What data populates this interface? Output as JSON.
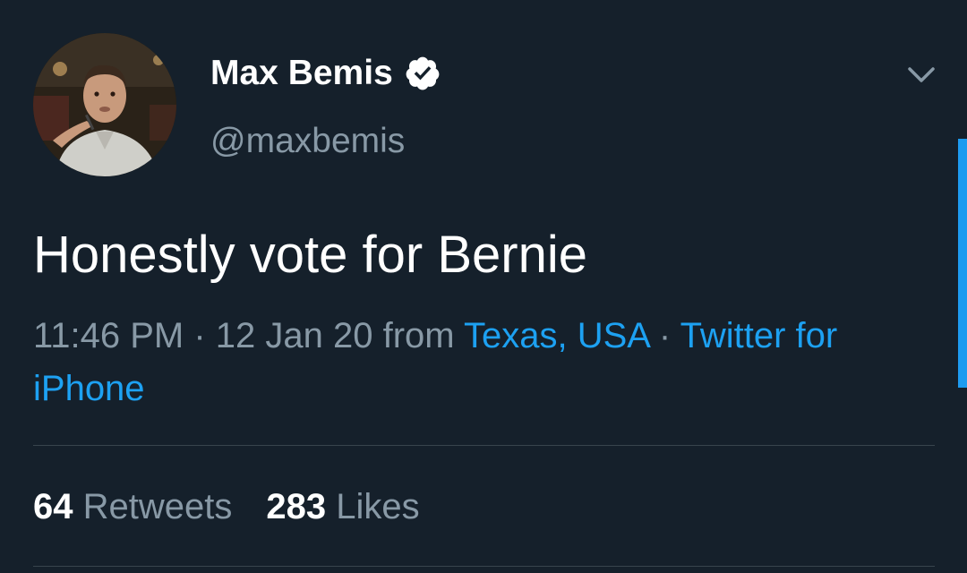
{
  "tweet": {
    "author": {
      "name": "Max Bemis",
      "handle": "@maxbemis",
      "verified": true,
      "avatar": "profile-photo"
    },
    "text": "Honestly vote for Bernie",
    "time": "11:46 PM",
    "sep1": " · ",
    "date": "12 Jan 20",
    "from_word": " from ",
    "location": "Texas, USA",
    "sep2": " · ",
    "source": "Twitter for iPhone",
    "stats": {
      "retweets_count": "64",
      "retweets_label": "Retweets",
      "likes_count": "283",
      "likes_label": "Likes"
    }
  },
  "icons": {
    "verified": "verified-badge-icon",
    "more": "chevron-down-icon"
  },
  "colors": {
    "background": "#15202b",
    "text_primary": "#ffffff",
    "text_secondary": "#8899a6",
    "link": "#1da1f2",
    "divider": "#38444d"
  }
}
